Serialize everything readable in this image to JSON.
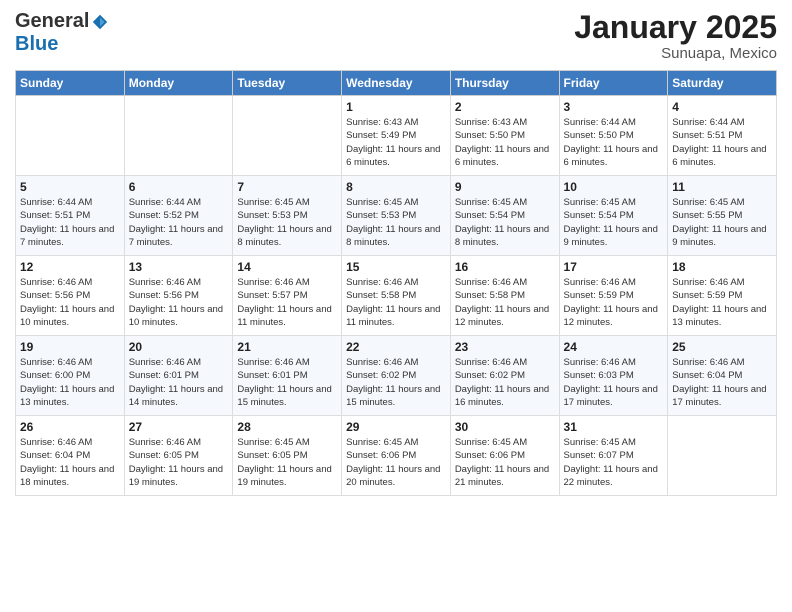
{
  "logo": {
    "general": "General",
    "blue": "Blue"
  },
  "title": "January 2025",
  "subtitle": "Sunuapa, Mexico",
  "header_days": [
    "Sunday",
    "Monday",
    "Tuesday",
    "Wednesday",
    "Thursday",
    "Friday",
    "Saturday"
  ],
  "weeks": [
    [
      {
        "day": "",
        "text": ""
      },
      {
        "day": "",
        "text": ""
      },
      {
        "day": "",
        "text": ""
      },
      {
        "day": "1",
        "text": "Sunrise: 6:43 AM\nSunset: 5:49 PM\nDaylight: 11 hours and 6 minutes."
      },
      {
        "day": "2",
        "text": "Sunrise: 6:43 AM\nSunset: 5:50 PM\nDaylight: 11 hours and 6 minutes."
      },
      {
        "day": "3",
        "text": "Sunrise: 6:44 AM\nSunset: 5:50 PM\nDaylight: 11 hours and 6 minutes."
      },
      {
        "day": "4",
        "text": "Sunrise: 6:44 AM\nSunset: 5:51 PM\nDaylight: 11 hours and 6 minutes."
      }
    ],
    [
      {
        "day": "5",
        "text": "Sunrise: 6:44 AM\nSunset: 5:51 PM\nDaylight: 11 hours and 7 minutes."
      },
      {
        "day": "6",
        "text": "Sunrise: 6:44 AM\nSunset: 5:52 PM\nDaylight: 11 hours and 7 minutes."
      },
      {
        "day": "7",
        "text": "Sunrise: 6:45 AM\nSunset: 5:53 PM\nDaylight: 11 hours and 8 minutes."
      },
      {
        "day": "8",
        "text": "Sunrise: 6:45 AM\nSunset: 5:53 PM\nDaylight: 11 hours and 8 minutes."
      },
      {
        "day": "9",
        "text": "Sunrise: 6:45 AM\nSunset: 5:54 PM\nDaylight: 11 hours and 8 minutes."
      },
      {
        "day": "10",
        "text": "Sunrise: 6:45 AM\nSunset: 5:54 PM\nDaylight: 11 hours and 9 minutes."
      },
      {
        "day": "11",
        "text": "Sunrise: 6:45 AM\nSunset: 5:55 PM\nDaylight: 11 hours and 9 minutes."
      }
    ],
    [
      {
        "day": "12",
        "text": "Sunrise: 6:46 AM\nSunset: 5:56 PM\nDaylight: 11 hours and 10 minutes."
      },
      {
        "day": "13",
        "text": "Sunrise: 6:46 AM\nSunset: 5:56 PM\nDaylight: 11 hours and 10 minutes."
      },
      {
        "day": "14",
        "text": "Sunrise: 6:46 AM\nSunset: 5:57 PM\nDaylight: 11 hours and 11 minutes."
      },
      {
        "day": "15",
        "text": "Sunrise: 6:46 AM\nSunset: 5:58 PM\nDaylight: 11 hours and 11 minutes."
      },
      {
        "day": "16",
        "text": "Sunrise: 6:46 AM\nSunset: 5:58 PM\nDaylight: 11 hours and 12 minutes."
      },
      {
        "day": "17",
        "text": "Sunrise: 6:46 AM\nSunset: 5:59 PM\nDaylight: 11 hours and 12 minutes."
      },
      {
        "day": "18",
        "text": "Sunrise: 6:46 AM\nSunset: 5:59 PM\nDaylight: 11 hours and 13 minutes."
      }
    ],
    [
      {
        "day": "19",
        "text": "Sunrise: 6:46 AM\nSunset: 6:00 PM\nDaylight: 11 hours and 13 minutes."
      },
      {
        "day": "20",
        "text": "Sunrise: 6:46 AM\nSunset: 6:01 PM\nDaylight: 11 hours and 14 minutes."
      },
      {
        "day": "21",
        "text": "Sunrise: 6:46 AM\nSunset: 6:01 PM\nDaylight: 11 hours and 15 minutes."
      },
      {
        "day": "22",
        "text": "Sunrise: 6:46 AM\nSunset: 6:02 PM\nDaylight: 11 hours and 15 minutes."
      },
      {
        "day": "23",
        "text": "Sunrise: 6:46 AM\nSunset: 6:02 PM\nDaylight: 11 hours and 16 minutes."
      },
      {
        "day": "24",
        "text": "Sunrise: 6:46 AM\nSunset: 6:03 PM\nDaylight: 11 hours and 17 minutes."
      },
      {
        "day": "25",
        "text": "Sunrise: 6:46 AM\nSunset: 6:04 PM\nDaylight: 11 hours and 17 minutes."
      }
    ],
    [
      {
        "day": "26",
        "text": "Sunrise: 6:46 AM\nSunset: 6:04 PM\nDaylight: 11 hours and 18 minutes."
      },
      {
        "day": "27",
        "text": "Sunrise: 6:46 AM\nSunset: 6:05 PM\nDaylight: 11 hours and 19 minutes."
      },
      {
        "day": "28",
        "text": "Sunrise: 6:45 AM\nSunset: 6:05 PM\nDaylight: 11 hours and 19 minutes."
      },
      {
        "day": "29",
        "text": "Sunrise: 6:45 AM\nSunset: 6:06 PM\nDaylight: 11 hours and 20 minutes."
      },
      {
        "day": "30",
        "text": "Sunrise: 6:45 AM\nSunset: 6:06 PM\nDaylight: 11 hours and 21 minutes."
      },
      {
        "day": "31",
        "text": "Sunrise: 6:45 AM\nSunset: 6:07 PM\nDaylight: 11 hours and 22 minutes."
      },
      {
        "day": "",
        "text": ""
      }
    ]
  ]
}
